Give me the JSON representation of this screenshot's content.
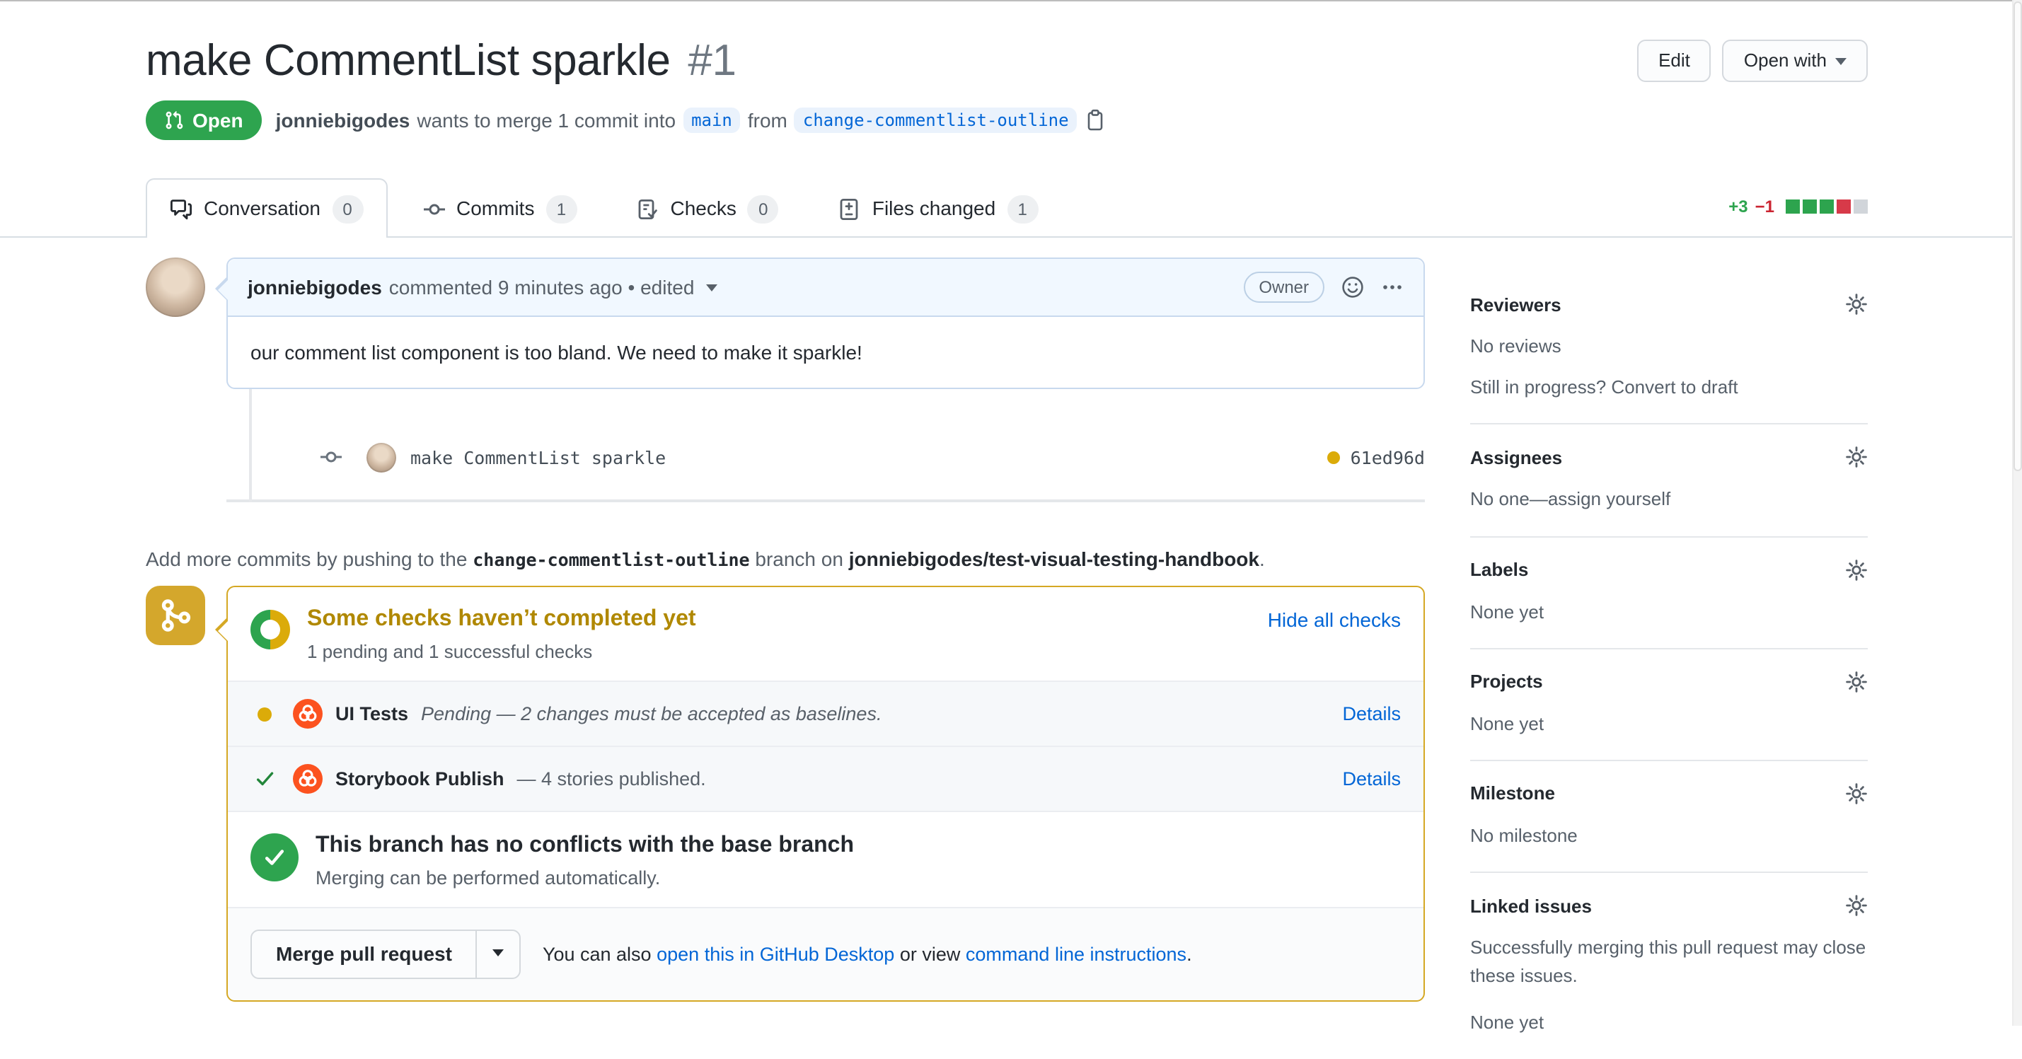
{
  "page": {
    "title": "make CommentList sparkle",
    "number": "#1"
  },
  "header": {
    "edit_button": "Edit",
    "open_with_button": "Open with",
    "status_badge": "Open",
    "author": "jonniebigodes",
    "merge_text_1": "wants to merge 1 commit into",
    "base_branch": "main",
    "merge_text_2": "from",
    "head_branch": "change-commentlist-outline"
  },
  "tabs": [
    {
      "label": "Conversation",
      "count": "0"
    },
    {
      "label": "Commits",
      "count": "1"
    },
    {
      "label": "Checks",
      "count": "0"
    },
    {
      "label": "Files changed",
      "count": "1"
    }
  ],
  "diffstat": {
    "additions": "+3",
    "deletions": "−1"
  },
  "conversation": {
    "comment": {
      "author": "jonniebigodes",
      "meta": "commented 9 minutes ago • edited",
      "badge": "Owner",
      "body": "our comment list component is too bland. We need to make it sparkle!"
    },
    "commit": {
      "message": "make CommentList sparkle",
      "sha": "61ed96d"
    },
    "add_more": {
      "prefix": "Add more commits by pushing to the",
      "branch": "change-commentlist-outline",
      "middle": "branch on",
      "repo": "jonniebigodes/test-visual-testing-handbook",
      "suffix": "."
    }
  },
  "checks": {
    "title": "Some checks haven’t completed yet",
    "subtitle": "1 pending and 1 successful checks",
    "hide_link": "Hide all checks",
    "items": [
      {
        "name": "UI Tests",
        "status_text": "Pending — 2 changes must be accepted as baselines.",
        "details": "Details",
        "state": "pending"
      },
      {
        "name": "Storybook Publish",
        "status_text": "— 4 stories published.",
        "details": "Details",
        "state": "success"
      }
    ],
    "conflict_title": "This branch has no conflicts with the base branch",
    "conflict_subtitle": "Merging can be performed automatically.",
    "merge_button": "Merge pull request",
    "also_text_1": "You can also",
    "desktop_link": "open this in GitHub Desktop",
    "also_text_2": "or view",
    "cli_link": "command line instructions",
    "also_text_3": "."
  },
  "sidebar": {
    "sections": [
      {
        "title": "Reviewers",
        "lines": [
          "No reviews",
          "Still in progress? Convert to draft"
        ]
      },
      {
        "title": "Assignees",
        "lines": [
          "No one—assign yourself"
        ]
      },
      {
        "title": "Labels",
        "lines": [
          "None yet"
        ]
      },
      {
        "title": "Projects",
        "lines": [
          "None yet"
        ]
      },
      {
        "title": "Milestone",
        "lines": [
          "No milestone"
        ]
      },
      {
        "title": "Linked issues",
        "lines": [
          "Successfully merging this pull request may close these issues.",
          "None yet"
        ]
      }
    ]
  },
  "colors": {
    "open_badge_green": "#2ea44f",
    "success_green": "#22863a",
    "pending_yellow": "#dbab09",
    "attention_amber": "#b08800",
    "attention_border": "#d5a824",
    "link_blue": "#0366d6",
    "addition_green": "#2da44e",
    "deletion_red": "#d73a49",
    "chromatic_orange": "#fc521f"
  }
}
